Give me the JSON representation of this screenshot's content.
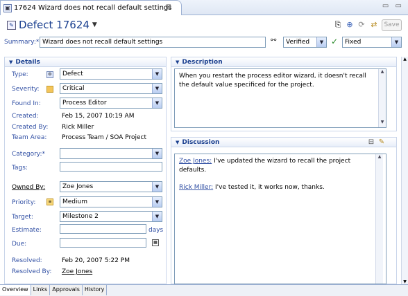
{
  "tab": {
    "title": "17624  Wizard does not recall default settings",
    "close": "⊠"
  },
  "window": {
    "controls": "▭ ▭"
  },
  "header": {
    "title": "Defect 17624",
    "save_label": "Save",
    "summary_label": "Summary:*",
    "summary_value": "Wizard does not recall default settings",
    "state_value": "Verified",
    "resolution_value": "Fixed"
  },
  "details": {
    "title": "Details",
    "type_label": "Type:",
    "type_value": "Defect",
    "severity_label": "Severity:",
    "severity_value": "Critical",
    "found_in_label": "Found In:",
    "found_in_value": "Process Editor",
    "created_label": "Created:",
    "created_value": "Feb 15, 2007 10:19 AM",
    "created_by_label": "Created By:",
    "created_by_value": "Rick Miller",
    "team_area_label": "Team Area:",
    "team_area_value": "Process Team / SOA Project",
    "category_label": "Category:*",
    "category_value": "",
    "tags_label": "Tags:",
    "tags_value": "",
    "owned_by_label": "Owned By:",
    "owned_by_value": "Zoe Jones",
    "priority_label": "Priority:",
    "priority_value": "Medium",
    "target_label": "Target:",
    "target_value": "Milestone 2",
    "estimate_label": "Estimate:",
    "estimate_value": "",
    "estimate_unit": "days",
    "due_label": "Due:",
    "due_value": "",
    "resolved_label": "Resolved:",
    "resolved_value": "Feb 20, 2007 5:22 PM",
    "resolved_by_label": "Resolved By:",
    "resolved_by_value": "Zoe Jones"
  },
  "description": {
    "title": "Description",
    "text": "When you restart the process editor wizard, it doesn't recall the default value specificed for the project."
  },
  "discussion": {
    "title": "Discussion",
    "comments": [
      {
        "author": "Zoe Jones:",
        "text": "I've updated the wizard to recall the project defaults."
      },
      {
        "author": "Rick Miller:",
        "text": "I've tested it, it works now, thanks."
      }
    ]
  },
  "bottom_tabs": [
    "Overview",
    "Links",
    "Approvals",
    "History"
  ]
}
